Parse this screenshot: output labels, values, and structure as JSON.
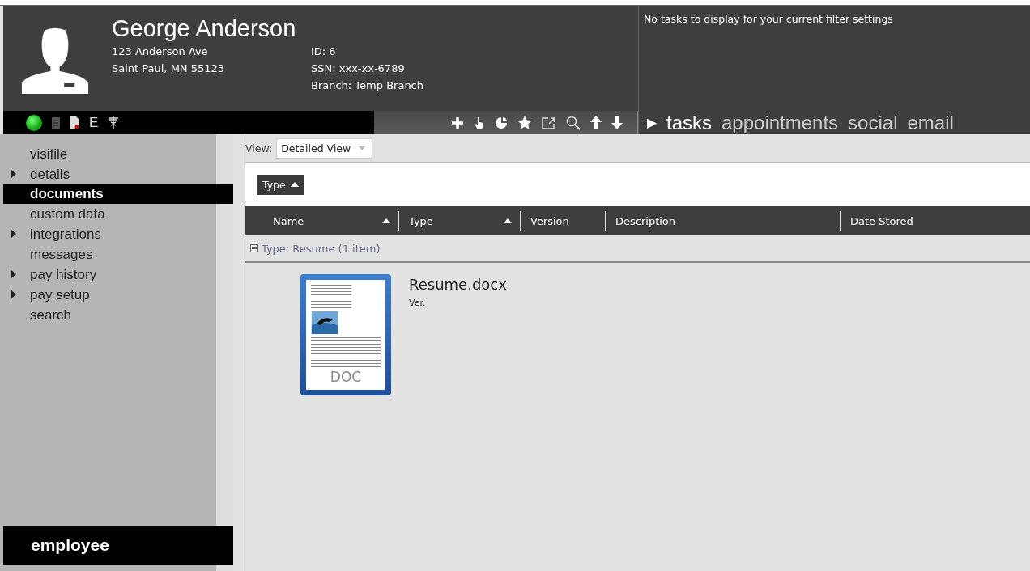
{
  "profile": {
    "name": "George Anderson",
    "address": [
      "123 Anderson Ave",
      "Saint Paul, MN 55123"
    ],
    "fields": [
      {
        "label": "ID:",
        "value": "6"
      },
      {
        "label": "SSN:",
        "value": "xxx-xx-6789"
      },
      {
        "label": "Branch:",
        "value": "Temp Branch"
      }
    ]
  },
  "status_icons": {
    "online": true,
    "letter": "E"
  },
  "tasks_panel": {
    "message": "No tasks to display for your current filter settings"
  },
  "panel_tabs": {
    "arrow": "▶",
    "items": [
      {
        "label": "tasks",
        "selected": true
      },
      {
        "label": "appointments",
        "selected": false
      },
      {
        "label": "social",
        "selected": false
      },
      {
        "label": "email",
        "selected": false
      }
    ]
  },
  "sidebar": {
    "items": [
      {
        "label": "visifile",
        "expandable": false,
        "selected": false
      },
      {
        "label": "details",
        "expandable": true,
        "selected": false
      },
      {
        "label": "documents",
        "expandable": false,
        "selected": true
      },
      {
        "label": "custom data",
        "expandable": false,
        "selected": false
      },
      {
        "label": "integrations",
        "expandable": true,
        "selected": false
      },
      {
        "label": "messages",
        "expandable": false,
        "selected": false
      },
      {
        "label": "pay history",
        "expandable": true,
        "selected": false
      },
      {
        "label": "pay setup",
        "expandable": true,
        "selected": false
      },
      {
        "label": "search",
        "expandable": false,
        "selected": false
      }
    ],
    "footer": "employee"
  },
  "view": {
    "label": "View:",
    "value": "Detailed View"
  },
  "grouping": {
    "label": "Type",
    "sorted": true
  },
  "table": {
    "columns": [
      {
        "label": "Name",
        "sorted": true
      },
      {
        "label": "Type",
        "sorted": true
      },
      {
        "label": "Version",
        "sorted": false
      },
      {
        "label": "Description",
        "sorted": false
      },
      {
        "label": "Date Stored",
        "sorted": false
      }
    ],
    "groups": [
      {
        "label": "Type: Resume (1 item)",
        "expanded": true,
        "documents": [
          {
            "name": "Resume.docx",
            "version": "Ver.",
            "icon_label": "DOC"
          }
        ]
      }
    ]
  }
}
